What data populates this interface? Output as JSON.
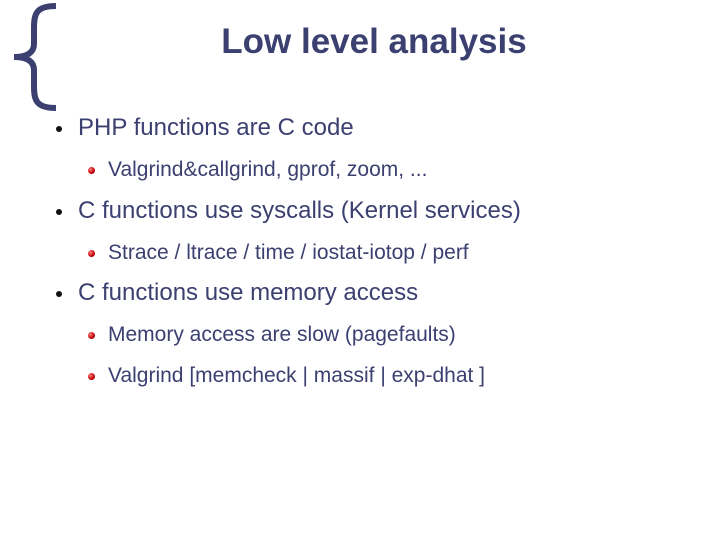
{
  "slide": {
    "title": "Low level analysis",
    "bullets": [
      {
        "text": "PHP functions are C code",
        "sub": [
          "Valgrind&callgrind, gprof, zoom, ..."
        ]
      },
      {
        "text": "C functions use syscalls (Kernel services)",
        "sub": [
          "Strace / ltrace / time / iostat-iotop / perf"
        ]
      },
      {
        "text": "C functions use memory access",
        "sub": [
          "Memory access are slow (pagefaults)",
          "Valgrind [memcheck | massif | exp-dhat ]"
        ]
      }
    ],
    "colors": {
      "text": "#3b4070",
      "sub_bullet": "#c00000"
    }
  }
}
